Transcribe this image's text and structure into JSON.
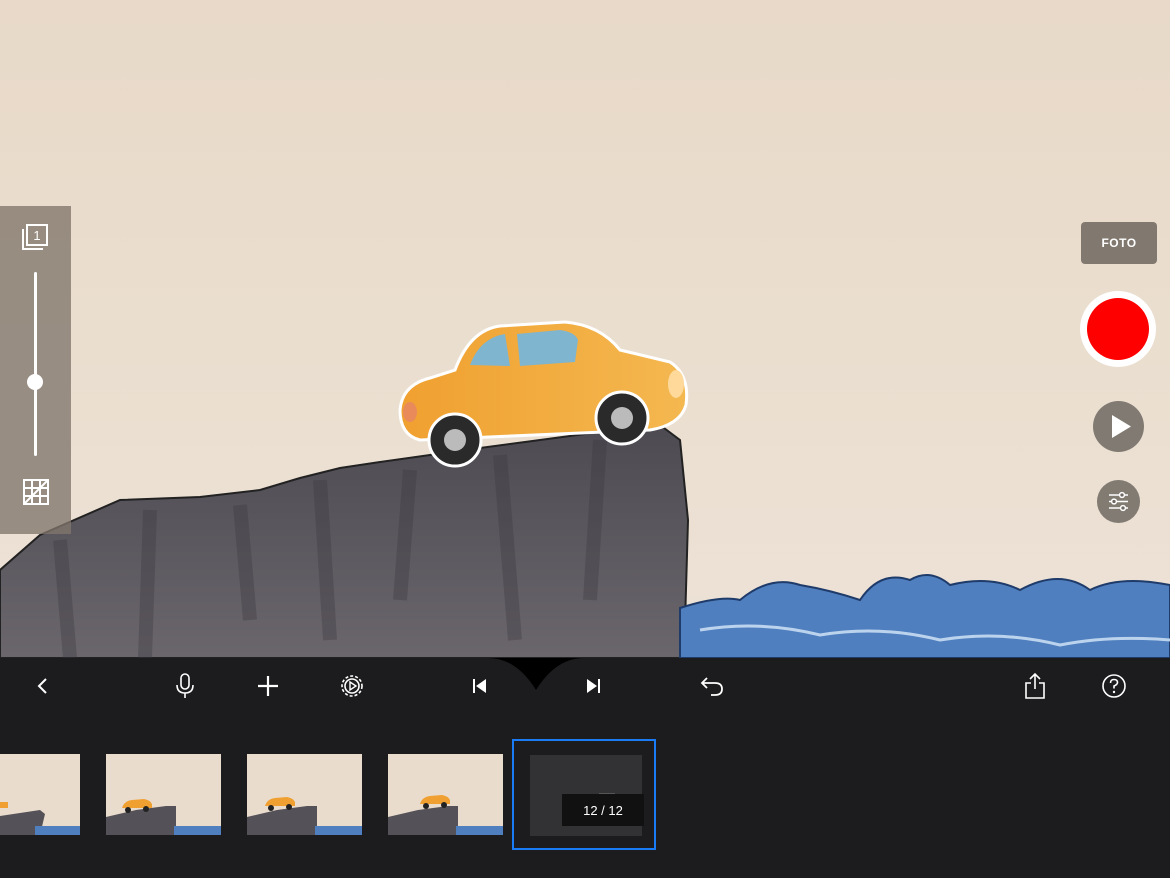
{
  "camera": {
    "foto_label": "FOTO",
    "record_color": "#ff0000"
  },
  "onion_skin": {
    "frames_icon_value": "1",
    "opacity_level": 0.42
  },
  "toolbar": {
    "icons": [
      "back-icon",
      "microphone-icon",
      "add-icon",
      "settings-icon",
      "previous-frame-icon",
      "next-frame-icon",
      "undo-icon",
      "share-icon",
      "help-icon"
    ]
  },
  "filmstrip": {
    "frame_counter": "12 / 12",
    "selection_color": "#1a7cf5",
    "thumbnails": [
      "frame-thumbnail",
      "frame-thumbnail",
      "frame-thumbnail",
      "frame-thumbnail"
    ]
  }
}
